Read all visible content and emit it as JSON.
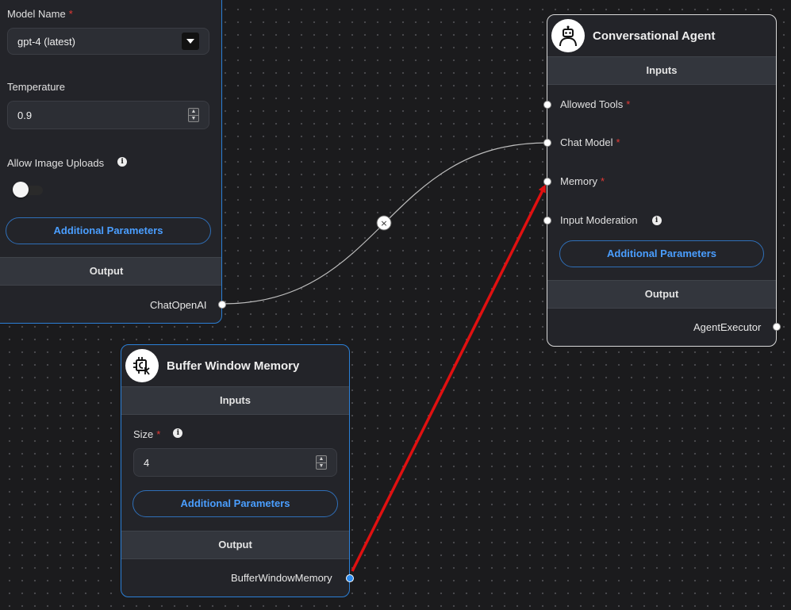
{
  "chat_node": {
    "model_name_label": "Model Name",
    "model_name_value": "gpt-4 (latest)",
    "temperature_label": "Temperature",
    "temperature_value": "0.9",
    "allow_image_uploads_label": "Allow Image Uploads",
    "allow_image_uploads_on": false,
    "additional_parameters_label": "Additional Parameters",
    "output_header": "Output",
    "output_label": "ChatOpenAI"
  },
  "agent_node": {
    "title": "Conversational Agent",
    "avatar_icon": "robot-icon",
    "inputs_header": "Inputs",
    "inputs": [
      {
        "label": "Allowed Tools",
        "required": true
      },
      {
        "label": "Chat Model",
        "required": true
      },
      {
        "label": "Memory",
        "required": true
      },
      {
        "label": "Input Moderation",
        "required": false,
        "info": true
      }
    ],
    "additional_parameters_label": "Additional Parameters",
    "output_header": "Output",
    "output_label": "AgentExecutor"
  },
  "memory_node": {
    "title": "Buffer Window Memory",
    "avatar_icon": "memory-chip-icon",
    "inputs_header": "Inputs",
    "size_label": "Size",
    "size_value": "4",
    "additional_parameters_label": "Additional Parameters",
    "output_header": "Output",
    "output_label": "BufferWindowMemory"
  },
  "required_marker": "*",
  "info_glyph": "i",
  "edge_delete_glyph": "×",
  "colors": {
    "canvas_bg": "#1b1b1d",
    "node_bg": "#232429",
    "accent_blue": "#2b7fd6",
    "link_blue": "#4a9eff",
    "required_red": "#e53935",
    "arrow_red": "#e01010"
  }
}
